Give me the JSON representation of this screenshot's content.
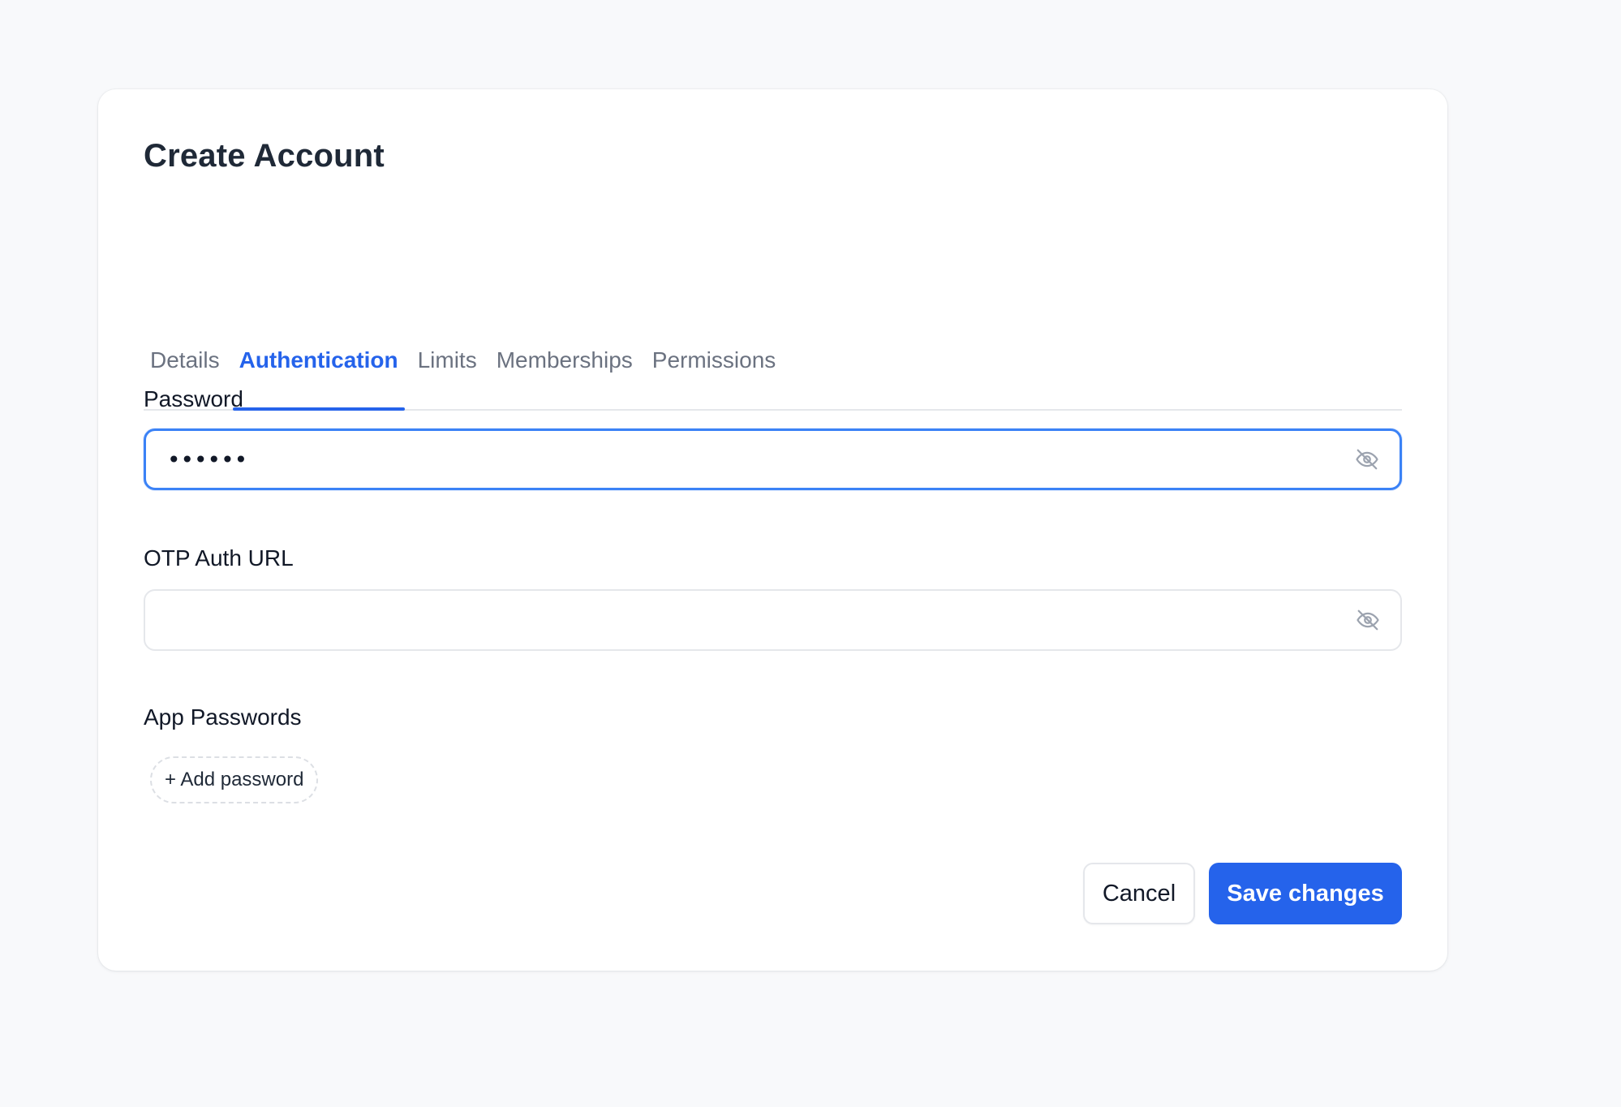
{
  "dialog": {
    "title": "Create Account"
  },
  "tabs": [
    {
      "label": "Details",
      "active": false
    },
    {
      "label": "Authentication",
      "active": true
    },
    {
      "label": "Limits",
      "active": false
    },
    {
      "label": "Memberships",
      "active": false
    },
    {
      "label": "Permissions",
      "active": false
    }
  ],
  "password": {
    "label": "Password",
    "value": "••••••",
    "toggle_icon": "eye-off-icon"
  },
  "otp": {
    "label": "OTP Auth URL",
    "value": "",
    "toggle_icon": "eye-off-icon"
  },
  "app_passwords": {
    "label": "App Passwords",
    "add_label": "+ Add password"
  },
  "actions": {
    "cancel_label": "Cancel",
    "save_label": "Save changes"
  },
  "colors": {
    "accent": "#2563eb",
    "focus_ring": "#3b82f6",
    "background": "#f8f9fb",
    "muted_text": "#6b7280"
  }
}
